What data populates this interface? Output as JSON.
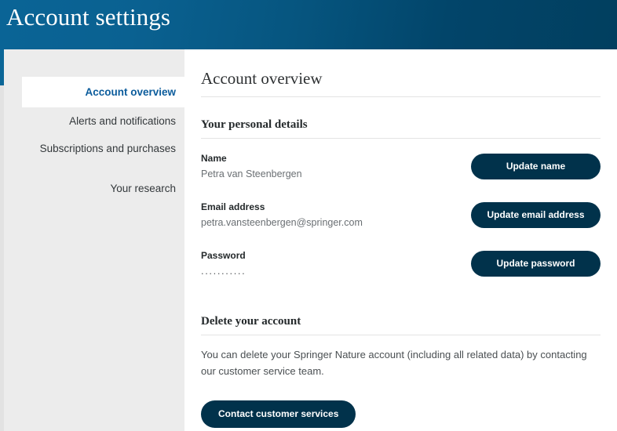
{
  "header": {
    "title": "Account settings",
    "gradient_from": "#0a6496",
    "gradient_to": "#013f5f"
  },
  "sidebar": {
    "background": "#ececec",
    "accent_color": "#0b6697",
    "active_text_color": "#0b5c9c",
    "items": [
      {
        "label": "Account overview",
        "active": true
      },
      {
        "label": "Alerts and notifications",
        "active": false
      },
      {
        "label": "Subscriptions and purchases",
        "active": false
      },
      {
        "label": "Your research",
        "active": false
      }
    ]
  },
  "main": {
    "page_heading": "Account overview",
    "personal_details": {
      "heading": "Your personal details",
      "rows": [
        {
          "label": "Name",
          "value": "Petra van Steenbergen",
          "button": "Update name"
        },
        {
          "label": "Email address",
          "value": "petra.vansteenbergen@springer.com",
          "button": "Update email address"
        },
        {
          "label": "Password",
          "value": "...........",
          "button": "Update password"
        }
      ]
    },
    "delete_account": {
      "heading": "Delete your account",
      "body": "You can delete your Springer Nature account (including all related data) by contacting our customer service team.",
      "button": "Contact customer services"
    }
  },
  "colors": {
    "button_navy": "#01324b",
    "rule": "#e4e4e4"
  }
}
